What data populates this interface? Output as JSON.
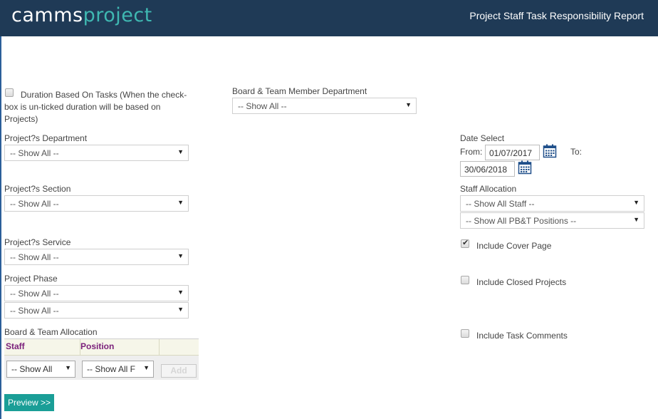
{
  "header": {
    "logo_part1": "camms",
    "logo_part2": "project",
    "title": "Project Staff Task Responsibility Report"
  },
  "filters": {
    "duration_checkbox_label_line1": "Duration Based On Tasks (When the check-",
    "duration_checkbox_label_line2": "box is un-ticked duration will be based on",
    "duration_checkbox_label_line3": "Projects)",
    "duration_checked": false,
    "board_team_member_department_label": "Board & Team Member Department",
    "board_team_member_department_value": "-- Show All --",
    "projects_department_label": "Project?s Department",
    "projects_department_value": "-- Show All --",
    "projects_section_label": "Project?s Section",
    "projects_section_value": "-- Show All --",
    "projects_service_label": "Project?s Service",
    "projects_service_value": "-- Show All --",
    "project_phase_label": "Project Phase",
    "project_phase_value_1": "-- Show All --",
    "project_phase_value_2": "-- Show All --"
  },
  "date_select": {
    "label": "Date Select",
    "from_label": "From:",
    "from_value": "01/07/2017",
    "to_label": "To:",
    "to_value": "30/06/2018"
  },
  "staff_allocation": {
    "label": "Staff Allocation",
    "staff_value": "-- Show All Staff --",
    "positions_value": "-- Show All PB&T Positions --"
  },
  "options": {
    "include_cover_page_label": "Include Cover Page",
    "include_cover_page_checked": true,
    "include_closed_projects_label": "Include Closed Projects",
    "include_closed_projects_checked": false,
    "include_task_comments_label": "Include Task Comments",
    "include_task_comments_checked": false
  },
  "board_team_allocation": {
    "label": "Board & Team Allocation",
    "col_staff": "Staff",
    "col_position": "Position",
    "staff_value": "-- Show All",
    "position_value": "-- Show All F",
    "add_label": "Add"
  },
  "actions": {
    "preview_label": "Preview >>"
  },
  "icons": {
    "dropdown": "caret-down-icon",
    "calendar": "calendar-icon",
    "checkbox": "checkbox-icon"
  },
  "colors": {
    "header_bg": "#1f3a56",
    "logo_accent": "#3fb8b2",
    "preview_button": "#1a9e97",
    "grid_header_text": "#7a1f7a"
  }
}
